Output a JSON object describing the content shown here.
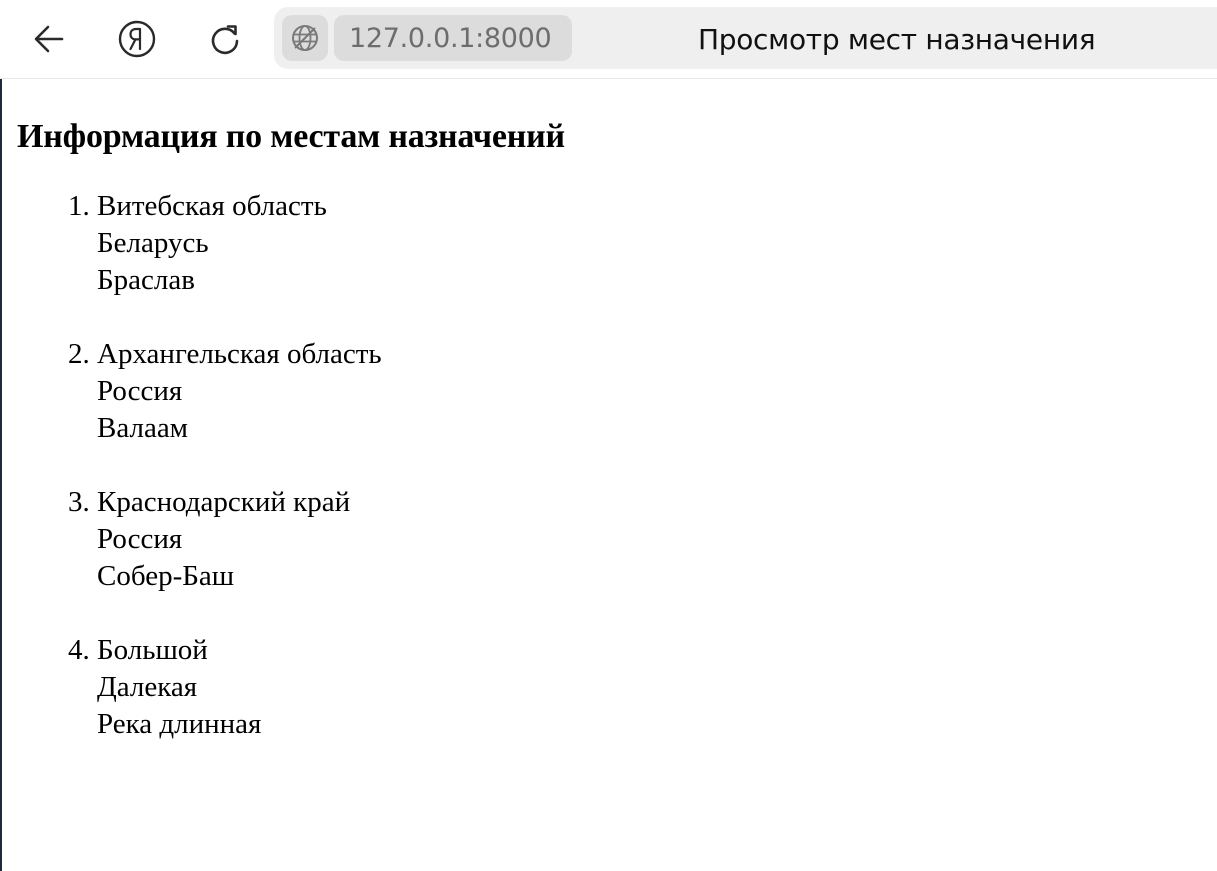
{
  "browser": {
    "url": "127.0.0.1:8000",
    "tab_title": "Просмотр мест назначения",
    "icons": {
      "back": "arrow-left-icon",
      "home": "yandex-logo-icon",
      "reload": "reload-icon",
      "site": "globe-icon"
    }
  },
  "page": {
    "heading": "Информация по местам назначений",
    "destinations": [
      {
        "region": "Витебская область",
        "country": "Беларусь",
        "place": "Браслав"
      },
      {
        "region": "Архангельская область",
        "country": "Россия",
        "place": "Валаам"
      },
      {
        "region": "Краснодарский край",
        "country": "Россия",
        "place": "Собер-Баш"
      },
      {
        "region": "Большой",
        "country": "Далекая",
        "place": "Река длинная"
      }
    ]
  }
}
